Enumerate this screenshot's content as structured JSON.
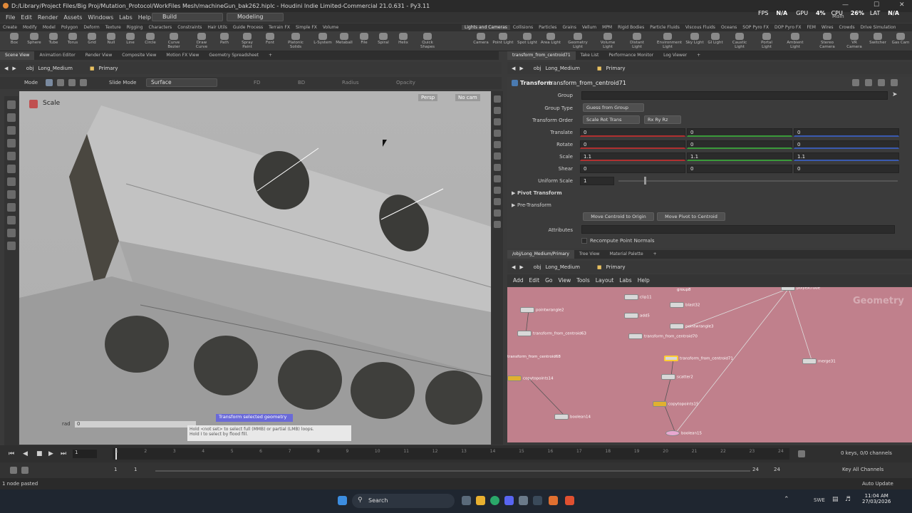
{
  "titlebar": {
    "title": "D:/Library/Project Files/Big Proj/Mutation_Protocol/WorkFiles Mesh/machineGun_bak262.hiplc - Houdini Indie Limited-Commercial 21.0.631 - Py3.11",
    "minimize": "—",
    "maximize": "☐",
    "close": "✕"
  },
  "menubar": {
    "items": [
      "File",
      "Edit",
      "Render",
      "Assets",
      "Windows",
      "Labs",
      "Help"
    ],
    "build": "Build",
    "desktop": "Modeling",
    "fps_label": "FPS",
    "fps_value": "N/A",
    "gpu_label": "GPU",
    "gpu_value": "4%",
    "cpu_label": "CPU",
    "cpu_value": "26%",
    "lat_label": "LAT",
    "lat_value": "N/A",
    "main": "Main"
  },
  "shelf_tabs_left": [
    "Create",
    "Modify",
    "Model",
    "Polygon",
    "Deform",
    "Texture",
    "Rigging",
    "Characters",
    "Constraints",
    "Hair Utils",
    "Guide Process",
    "Terrain FX",
    "Simple FX",
    "Volume"
  ],
  "shelf_tabs_right": [
    "Lights and Cameras",
    "Collisions",
    "Particles",
    "Grains",
    "Vellum",
    "MPM",
    "Rigid Bodies",
    "Particle Fluids",
    "Viscous Fluids",
    "Oceans",
    "SOP Pyro FX",
    "DOP Pyro FX",
    "FEM",
    "Wires",
    "Crowds",
    "Drive Simulation"
  ],
  "shelf_tools_left": [
    "Box",
    "Sphere",
    "Tube",
    "Torus",
    "Grid",
    "Null",
    "Line",
    "Circle",
    "Curve Bezier",
    "Draw Curve",
    "Path",
    "Spray Paint",
    "Font",
    "Platonic Solids",
    "L-System",
    "Metaball",
    "File",
    "Spiral",
    "Helix",
    "Quick Shapes"
  ],
  "shelf_tools_right": [
    "Camera",
    "Point Light",
    "Spot Light",
    "Area Light",
    "Geometry Light",
    "Volume Light",
    "Distant Light",
    "Environment Light",
    "Sky Light",
    "GI Light",
    "Caustic Light",
    "Portal Light",
    "Ambient Light",
    "Stereo Camera",
    "VR Camera",
    "Switcher",
    "Gas Cam"
  ],
  "left_pane": {
    "tabs": [
      "Scene View",
      "Animation Editor",
      "Render View",
      "Composite View",
      "Motion FX View",
      "Geometry Spreadsheet"
    ],
    "path_root": "obj",
    "path_node": "Long_Medium",
    "path_leaf": "Primary",
    "mode_label": "Mode",
    "slide_mode": "Slide Mode",
    "surface": "Surface",
    "fd_label": "FD",
    "bd_label": "BD",
    "radius_label": "Radius",
    "opacity_label": "Opacity",
    "state_title": "Scale",
    "persp": "Persp",
    "nocam": "No cam",
    "rad_label": "rad",
    "rad_value": "0",
    "tooltip_title": "Transform selected geometry",
    "tooltip_line1": "Hold <not set> to select full (MMB) or partial (LMB) loops.",
    "tooltip_line2": "Hold I to select by flood fill."
  },
  "right_pane": {
    "tabs": [
      "transform_from_centroid71",
      "Take List",
      "Performance Monitor",
      "Log Viewer"
    ],
    "path_root": "obj",
    "path_node": "Long_Medium",
    "path_leaf": "Primary",
    "node_type": "Transform",
    "node_name": "transform_from_centroid71",
    "group_label": "Group",
    "group_type_label": "Group Type",
    "group_type_value": "Guess from Group",
    "xform_order_label": "Transform Order",
    "xform_order_value": "Scale Rot Trans",
    "rot_order_value": "Rx Ry Rz",
    "translate_label": "Translate",
    "translate": [
      "0",
      "0",
      "0"
    ],
    "rotate_label": "Rotate",
    "rotate": [
      "0",
      "0",
      "0"
    ],
    "scale_label": "Scale",
    "scale": [
      "1.1",
      "1.1",
      "1.1"
    ],
    "shear_label": "Shear",
    "shear": [
      "0",
      "0",
      "0"
    ],
    "uniform_scale_label": "Uniform Scale",
    "uniform_scale": "1",
    "pivot_transform": "Pivot Transform",
    "pre_transform": "Pre-Transform",
    "move_centroid_btn": "Move Centroid to Origin",
    "move_pivot_btn": "Move Pivot to Centroid",
    "attributes_label": "Attributes",
    "recompute_normals": "Recompute Point Normals"
  },
  "network_pane": {
    "tabs": [
      "/obj/Long_Medium/Primary",
      "Tree View",
      "Material Palette"
    ],
    "path_root": "obj",
    "path_node": "Long_Medium",
    "path_leaf": "Primary",
    "menu": [
      "Add",
      "Edit",
      "Go",
      "View",
      "Tools",
      "Layout",
      "Labs",
      "Help"
    ],
    "context_label": "Geometry",
    "nodes": [
      {
        "name": "pointwrangle2",
        "type": "white"
      },
      {
        "name": "transform_from_centroid63",
        "type": "white"
      },
      {
        "name": "transform_from_centroid68",
        "type": "white"
      },
      {
        "name": "copytopoints14",
        "type": "yellow"
      },
      {
        "name": "boolean14",
        "type": "white"
      },
      {
        "name": "clip11",
        "type": "white"
      },
      {
        "name": "add5",
        "type": "white"
      },
      {
        "name": "transform_from_centroid70",
        "type": "white"
      },
      {
        "name": "group8",
        "type": "white"
      },
      {
        "name": "blast32",
        "type": "white"
      },
      {
        "name": "pointwrangle3",
        "type": "white"
      },
      {
        "name": "transform_from_centroid71",
        "type": "selected"
      },
      {
        "name": "scatter2",
        "type": "white"
      },
      {
        "name": "copytopoints15",
        "type": "yellow"
      },
      {
        "name": "boolean15",
        "type": "white"
      },
      {
        "name": "merge31",
        "type": "white"
      },
      {
        "name": "polyextrude",
        "type": "white"
      }
    ]
  },
  "timeline": {
    "frame_current": "1",
    "ticks": [
      "1",
      "2",
      "3",
      "4",
      "5",
      "6",
      "7",
      "8",
      "9",
      "10",
      "11",
      "12",
      "13",
      "14",
      "15",
      "16",
      "17",
      "18",
      "19",
      "20",
      "21",
      "22",
      "23",
      "24"
    ],
    "range_start": "1",
    "range_start2": "1",
    "range_end": "24",
    "range_end2": "24",
    "keys_info": "0 keys, 0/0 channels",
    "key_all": "Key All Channels",
    "auto_update": "Auto Update"
  },
  "status": {
    "message": "1 node pasted"
  },
  "taskbar": {
    "search": "Search",
    "lang": "SWE",
    "time": "11:04 AM",
    "date": "27/03/2026"
  },
  "colors": {
    "network_bg": "#c0808c",
    "viewport_bg": "#b2b2b2",
    "accent": "#e0b030"
  }
}
